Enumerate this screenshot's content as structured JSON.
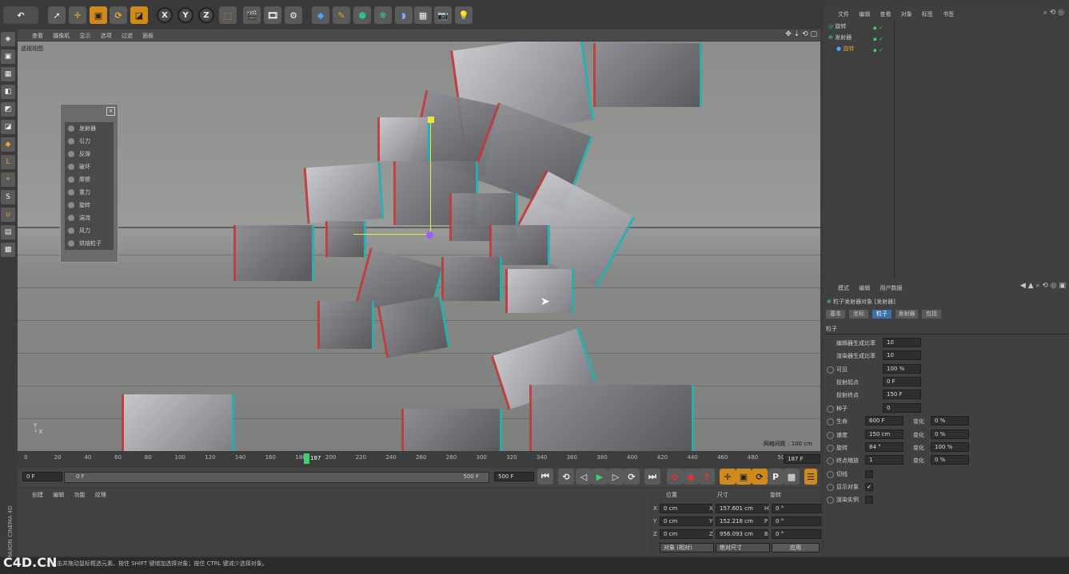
{
  "viewport": {
    "menu": [
      "查看",
      "摄像机",
      "显示",
      "选项",
      "过滤",
      "面板"
    ],
    "view_label": "透视视图",
    "grid_info": "网格间距 : 100 cm"
  },
  "toolbar": {
    "axis_buttons": [
      "X",
      "Y",
      "Z"
    ],
    "icons": [
      "undo-icon",
      "live-select-icon",
      "move-icon",
      "scale-icon",
      "rotate-icon",
      "recent-tool-icon",
      "x-axis-icon",
      "y-axis-icon",
      "z-axis-icon",
      "coord-system-icon",
      "render-view-icon",
      "render-picture-queue-icon",
      "render-settings-icon",
      "cube-icon",
      "pen-icon",
      "subdivision-icon",
      "array-icon",
      "deformer-icon",
      "floor-icon",
      "camera-icon",
      "light-icon"
    ]
  },
  "object_manager": {
    "menu": [
      "文件",
      "编辑",
      "查看",
      "对象",
      "标签",
      "书签"
    ],
    "items": [
      {
        "name": "旋转",
        "color": "#cfcfcf"
      },
      {
        "name": "发射器",
        "color": "#cfcfcf"
      },
      {
        "name": "旋转",
        "color": "#e0a030"
      }
    ]
  },
  "particle_panel": {
    "items": [
      "发射器",
      "引力",
      "反弹",
      "破坏",
      "摩擦",
      "重力",
      "旋转",
      "湍流",
      "风力",
      "烘焙粒子"
    ]
  },
  "timeline": {
    "ticks": [
      "0",
      "20",
      "40",
      "60",
      "80",
      "100",
      "120",
      "140",
      "160",
      "180",
      "200",
      "220",
      "240",
      "260",
      "280",
      "300",
      "320",
      "340",
      "360",
      "380",
      "400",
      "420",
      "440",
      "460",
      "480",
      "500"
    ],
    "current_frame": "187",
    "end_field": "187 F",
    "start_field": "0 F",
    "slider_left": "0 F",
    "slider_right": "500 F",
    "end_time": "500 F"
  },
  "material_manager": {
    "menu": [
      "创建",
      "编辑",
      "功能",
      "纹理"
    ]
  },
  "coordinates": {
    "headers": [
      "位置",
      "尺寸",
      "旋转"
    ],
    "rows": [
      {
        "axis": "X",
        "pos": "0 cm",
        "size_axis": "X",
        "size": "157.601 cm",
        "rot_axis": "H",
        "rot": "0 °"
      },
      {
        "axis": "Y",
        "pos": "0 cm",
        "size_axis": "Y",
        "size": "152.218 cm",
        "rot_axis": "P",
        "rot": "0 °"
      },
      {
        "axis": "Z",
        "pos": "0 cm",
        "size_axis": "Z",
        "size": "956.093 cm",
        "rot_axis": "B",
        "rot": "0 °"
      }
    ],
    "mode_dropdown": "对象 (相对)",
    "size_dropdown": "绝对尺寸",
    "apply": "应用"
  },
  "attributes": {
    "menu": [
      "模式",
      "编辑",
      "用户数据"
    ],
    "title": "粒子发射器对象 [发射器]",
    "tabs": [
      "基本",
      "坐标",
      "粒子",
      "发射器",
      "包括"
    ],
    "active_tab": "粒子",
    "section": "粒子",
    "fields": [
      {
        "label": "编辑器生成比率",
        "value": "10"
      },
      {
        "label": "渲染器生成比率",
        "value": "10"
      },
      {
        "label": "可见",
        "value": "100 %"
      },
      {
        "label": "投射起点",
        "value": "0 F"
      },
      {
        "label": "投射终点",
        "value": "150 F"
      },
      {
        "label": "种子",
        "value": "0"
      }
    ],
    "pair_fields": [
      {
        "label": "生命",
        "value": "600 F",
        "var_label": "变化",
        "var": "0 %"
      },
      {
        "label": "速度",
        "value": "150 cm",
        "var_label": "变化",
        "var": "0 %"
      },
      {
        "label": "旋转",
        "value": "84 °",
        "var_label": "变化",
        "var": "100 %"
      },
      {
        "label": "终点缩放",
        "value": "1",
        "var_label": "变化",
        "var": "0 %"
      }
    ],
    "checks": [
      {
        "label": "切线",
        "mark": ""
      },
      {
        "label": "显示对象",
        "mark": "✓"
      },
      {
        "label": "渲染实例",
        "mark": ""
      }
    ]
  },
  "status": {
    "text": "…：点击并拖动鼠标框选元素。按住 SHIFT 键增加选择对象；按住 CTRL 键减少选择对象。",
    "watermark": "C4D.CN",
    "brand": "MAXON CINEMA 4D"
  }
}
